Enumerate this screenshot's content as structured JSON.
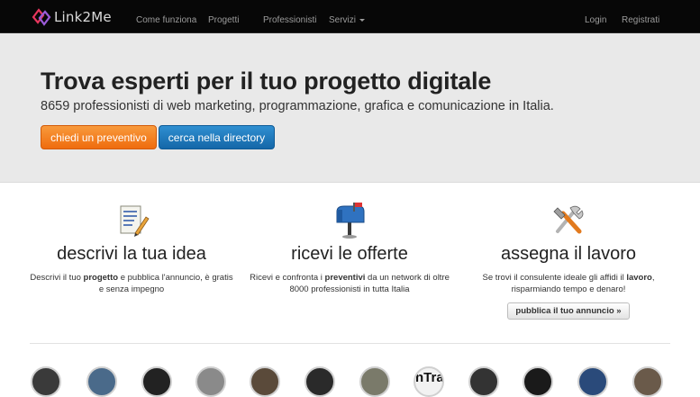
{
  "brand": {
    "name": "Link2Me"
  },
  "nav": {
    "left": [
      "Come funziona",
      "Progetti",
      "Professionisti",
      "Servizi"
    ],
    "right": [
      "Login",
      "Registrati"
    ]
  },
  "hero": {
    "title": "Trova esperti per il tuo progetto digitale",
    "subtitle": "8659 professionisti di web marketing, programmazione, grafica e comunicazione in Italia.",
    "btn_quote": "chiedi un preventivo",
    "btn_directory": "cerca nella directory"
  },
  "steps": [
    {
      "title": "descrivi la tua idea",
      "t1": "Descrivi il tuo ",
      "b1": "progetto",
      "t2": " e pubblica l'annuncio, è gratis e senza impegno",
      "icon": "document-edit-icon"
    },
    {
      "title": "ricevi le offerte",
      "t1": "Ricevi e confronta i ",
      "b1": "preventivi",
      "t2": " da un network di oltre 8000 professionisti in tutta Italia",
      "icon": "mailbox-icon"
    },
    {
      "title": "assegna il lavoro",
      "t1": "Se trovi il consulente ideale gli affidi il ",
      "b1": "lavoro",
      "t2": ", risparmiando tempo e denaro!",
      "icon": "tools-icon"
    }
  ],
  "publish_button": "pubblica il tuo annuncio »",
  "avatar_text": "nTra",
  "colors": {
    "navbar": "#070707",
    "hero": "#e9e9e9",
    "orange": "#ef6c0e",
    "blue": "#1467a8"
  }
}
